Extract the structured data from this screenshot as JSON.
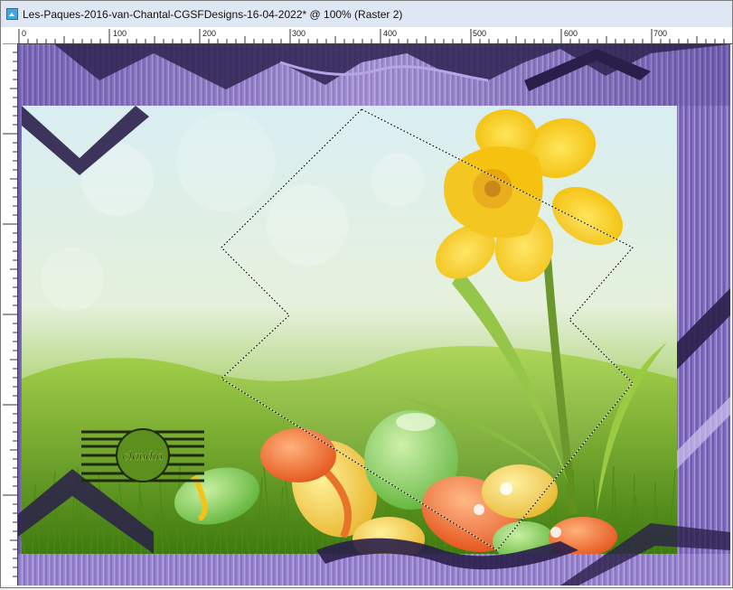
{
  "window": {
    "title": "Les-Paques-2016-van-Chantal-CGSFDesigns-16-04-2022* @ 100% (Raster 2)"
  },
  "ruler": {
    "top_labels": [
      "0",
      "100",
      "200",
      "300",
      "400",
      "500",
      "600",
      "700"
    ]
  },
  "canvas": {
    "frame_color": "#8b74c4",
    "dark_border_color": "#2a1f4a",
    "grass_color": "#7cb82a",
    "sky_color": "#d7ecf2"
  },
  "watermark": {
    "text": "claudia"
  }
}
